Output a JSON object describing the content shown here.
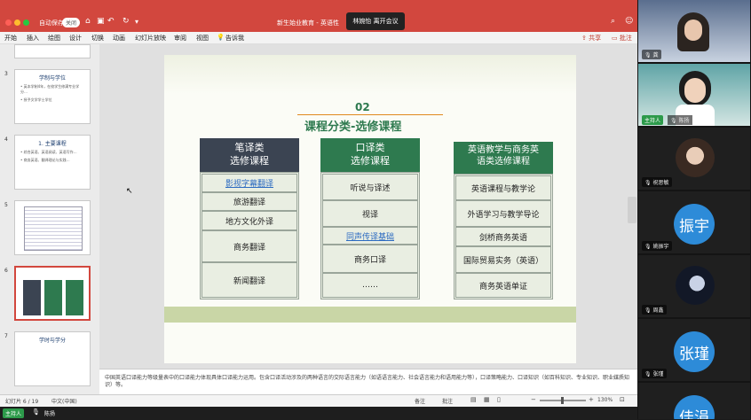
{
  "app": {
    "autosave_label": "自动保存",
    "autosave_state": "关闭",
    "doc_title": "新生始业教育 - 英语性",
    "meeting_banner": "林婉怡 离开会议"
  },
  "menu": [
    "开始",
    "插入",
    "绘图",
    "设计",
    "切换",
    "动画",
    "幻灯片放映",
    "审阅",
    "视图",
    "告诉我"
  ],
  "toolbar": {
    "share_label": "共享",
    "comment_label": "批注"
  },
  "sidebar": {
    "slides": [
      {
        "num": "3",
        "title": "学制与学位",
        "lines": [
          "• 英本学制4年，在校学生修满专业学分…",
          "• 授予文学学士学位"
        ]
      },
      {
        "num": "4",
        "title": "1. 主要课程",
        "lines": [
          "• 综合英语、英语阅读、英语写作…",
          "• 商务英语、翻译理论与实践…"
        ]
      },
      {
        "num": "5",
        "title": "",
        "lines": []
      },
      {
        "num": "6",
        "title": "",
        "lines": []
      },
      {
        "num": "7",
        "title": "学时与学分",
        "lines": []
      }
    ]
  },
  "slide": {
    "number_badge": "02",
    "title": "课程分类-选修课程",
    "columns": [
      {
        "header": "笔译类\n选修课程",
        "items": [
          "影视字幕翻译",
          "旅游翻译",
          "地方文化外译",
          "商务翻译",
          "新闻翻译"
        ]
      },
      {
        "header": "口译类\n选修课程",
        "items": [
          "听说与译述",
          "视译",
          "同声传译基础",
          "商务口译",
          "……"
        ]
      },
      {
        "header": "英语教学与商务英\n语类选修课程",
        "items": [
          "英语课程与教学论",
          "外语学习与教学导论",
          "剑桥商务英语",
          "国际贸易实务（英语）",
          "商务英语单证"
        ]
      }
    ]
  },
  "notes": "中国英语口译能力等级量表中的口译能力体现具体口译能力运用。包含口译活动涉及的两种语言的交际语言能力（如语语言能力、社会语言能力和语用能力等），口译策略能力、口译知识（如百科知识、专业知识、职业媒质知识）等。",
  "status": {
    "slide_info": "幻灯片 6 / 19",
    "language": "中文(中国)",
    "notes_label": "备注",
    "comments_label": "批注",
    "zoom": "130%"
  },
  "taskbar": {
    "host_label": "主持人",
    "speaker_name": "陈扬"
  },
  "participants": [
    {
      "name": "龚",
      "role": "",
      "type": "video"
    },
    {
      "name": "陈扬",
      "role": "主持人",
      "type": "video"
    },
    {
      "name": "祝思敏",
      "role": "",
      "type": "photo"
    },
    {
      "name": "姚振宇",
      "role": "",
      "type": "avatar",
      "avatar_text": "振宇"
    },
    {
      "name": "周鑫",
      "role": "",
      "type": "photo"
    },
    {
      "name": "张瑾",
      "role": "",
      "type": "avatar",
      "avatar_text": "张瑾"
    },
    {
      "name": "",
      "role": "",
      "type": "avatar",
      "avatar_text": "佳涓"
    }
  ],
  "colors": {
    "titlebar": "#d2473e",
    "header_dark": "#3b4452",
    "header_green": "#2e7a4f",
    "cell_bg": "#e9eee2",
    "link": "#2c6bc1",
    "accent_orange": "#e08a1e"
  }
}
